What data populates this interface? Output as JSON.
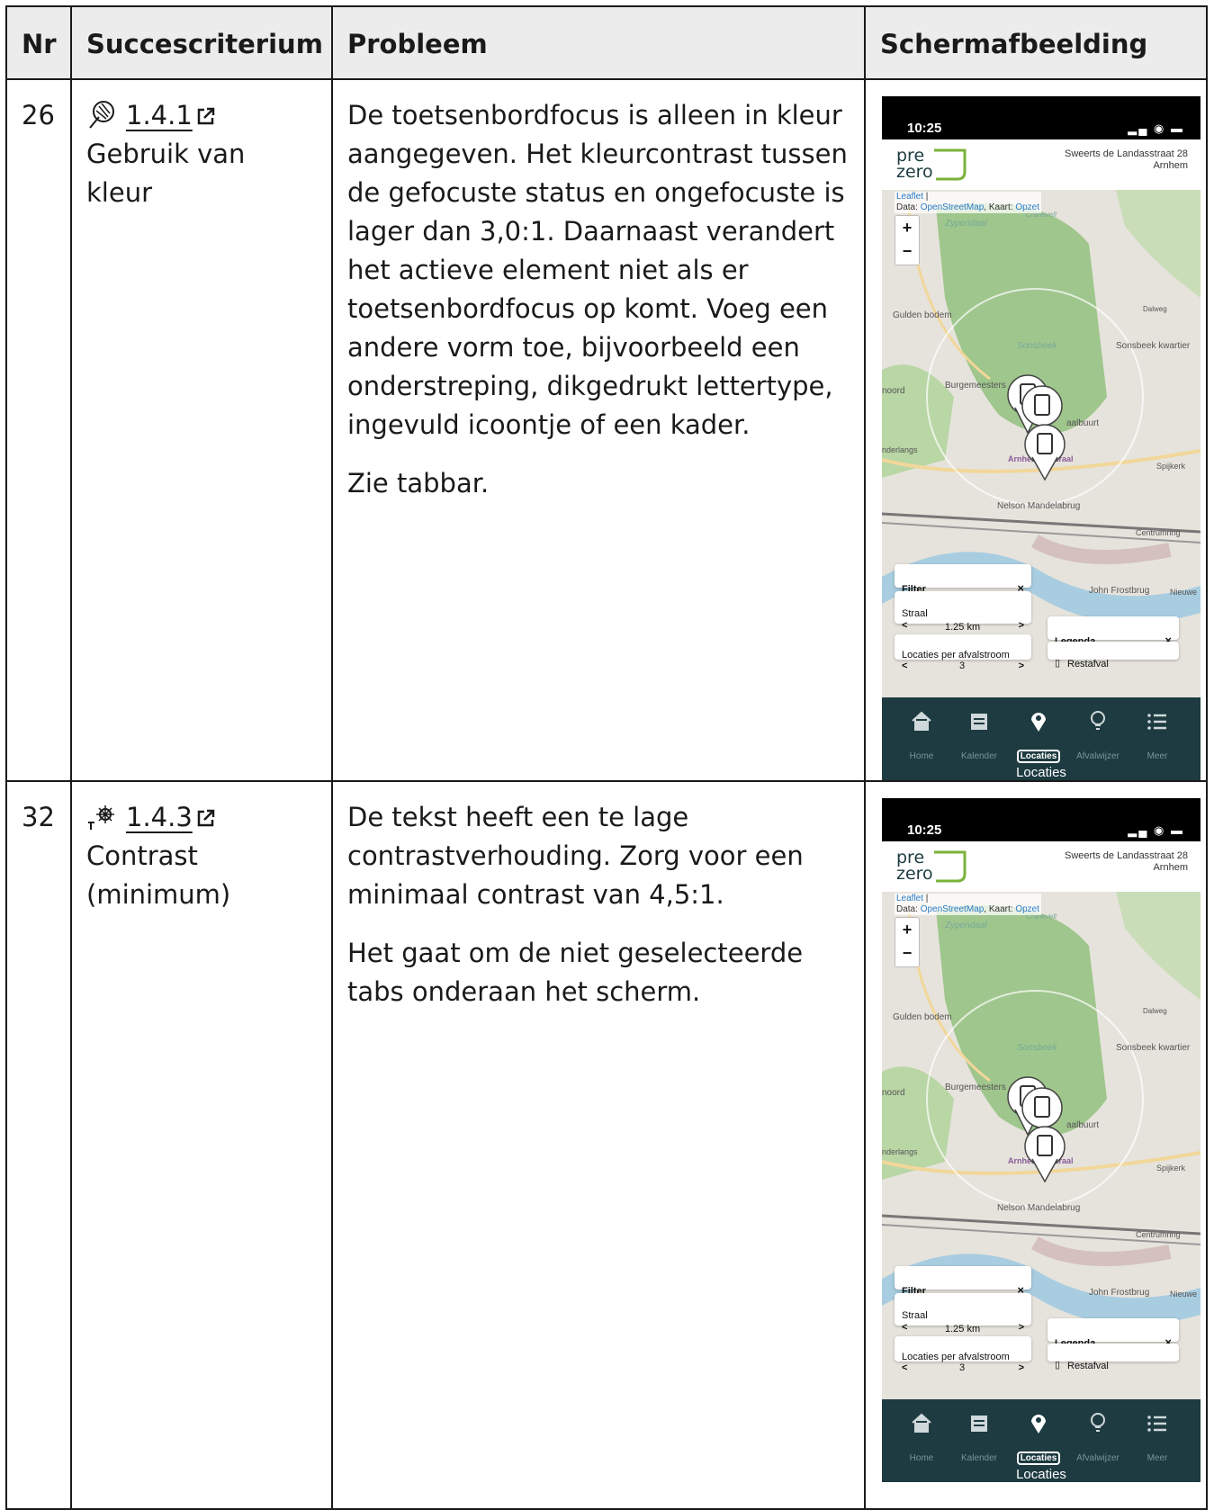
{
  "headers": {
    "nr": "Nr",
    "criterion": "Succescriterium",
    "problem": "Probleem",
    "screenshot": "Schermafbeelding"
  },
  "rows": [
    {
      "nr": "26",
      "criterion_icon": "color-palette-icon",
      "criterion_code": "1.4.1",
      "criterion_name": "Gebruik van kleur",
      "problem_p1": "De toetsenbordfocus is alleen in kleur aangegeven. Het kleurcontrast tussen de gefocuste status en ongefocuste is lager dan 3,0:1. Daarnaast verandert het actieve element niet als er toetsenbordfocus op komt. Voeg een andere vorm toe, bijvoorbeeld een onderstreping, dikgedrukt lettertype, ingevuld icoontje of een kader.",
      "problem_p2": "Zie tabbar."
    },
    {
      "nr": "32",
      "criterion_icon": "contrast-icon",
      "criterion_code": "1.4.3",
      "criterion_name": "Contrast (minimum)",
      "problem_p1": "De tekst heeft een te lage contrastverhouding. Zorg voor een minimaal contrast van 4,5:1.",
      "problem_p2": "Het gaat om de niet geselecteerde tabs onderaan het scherm."
    }
  ],
  "phone": {
    "time": "10:25",
    "logo_top": "pre",
    "logo_bottom": "zero",
    "address_line1": "Sweerts de Landasstraat 28",
    "address_line2": "Arnhem",
    "attrib_leaflet": "Leaflet",
    "attrib_data": "Data:",
    "attrib_osm": "OpenStreetMap",
    "attrib_kaart": ", Kaart:",
    "attrib_opzet": "Opzet",
    "zoom_in": "+",
    "zoom_out": "−",
    "map_labels": [
      "Zypendaal",
      "Gulden bodem",
      "Sonsbeek",
      "Sonsbeek kwartier",
      "Burgemeesters",
      "Arnhem Centraal",
      "Spijkerk",
      "Nelson Mandelabrug",
      "Centrumring",
      "John Frostbrug",
      "Nieuwe",
      "noord",
      "nderlangs",
      "aalbuurt",
      "Dalweg",
      "Cranevelt"
    ],
    "filter_label": "Filter",
    "close": "×",
    "straal_label": "Straal",
    "straal_value": "1.25 km",
    "locs_label": "Locaties per afvalstroom",
    "locs_value": "3",
    "legenda_label": "Legenda",
    "restafval_label": "Restafval",
    "prev": "<",
    "next": ">",
    "tabs": [
      {
        "label": "Home",
        "icon": "home-icon"
      },
      {
        "label": "Kalender",
        "icon": "calendar-icon"
      },
      {
        "label": "Locaties",
        "icon": "location-pin-icon"
      },
      {
        "label": "Afvalwijzer",
        "icon": "lightbulb-icon"
      },
      {
        "label": "Meer",
        "icon": "list-icon"
      }
    ],
    "tooltip": "Locaties"
  }
}
